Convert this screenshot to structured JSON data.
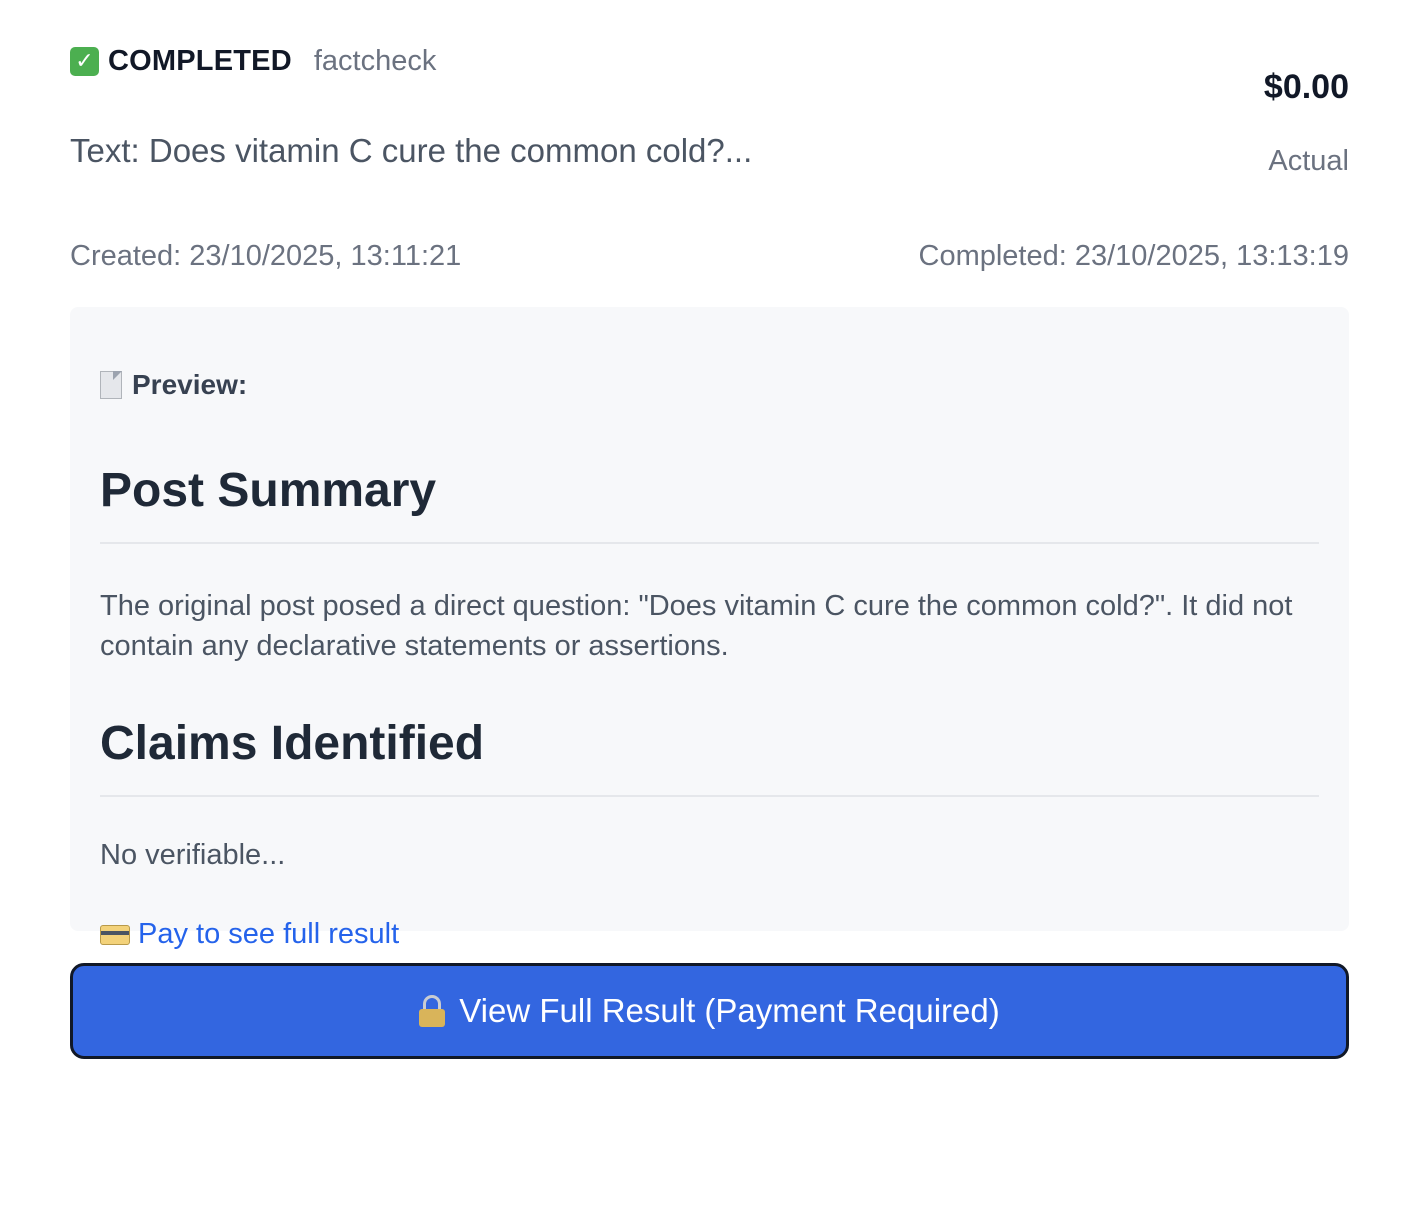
{
  "header": {
    "status_icon": "check-mark-icon",
    "status": "COMPLETED",
    "type": "factcheck",
    "subject": "Text: Does vitamin C cure the common cold?...",
    "price": "$0.00",
    "price_note": "Actual"
  },
  "meta": {
    "created": "Created: 23/10/2025, 13:11:21",
    "completed": "Completed: 23/10/2025, 13:13:19"
  },
  "preview": {
    "label": "Preview:",
    "icon": "document-icon",
    "sections": [
      {
        "heading": "Post Summary",
        "body": "The original post posed a direct question: \"Does vitamin C cure the common cold?\". It did not contain any declarative statements or assertions."
      },
      {
        "heading": "Claims Identified",
        "body": "No verifiable..."
      }
    ],
    "pay_link_icon": "credit-card-icon",
    "pay_link": "Pay to see full result"
  },
  "cta": {
    "icon": "lock-icon",
    "label": "View Full Result (Payment Required)",
    "color": "#3366e0"
  }
}
